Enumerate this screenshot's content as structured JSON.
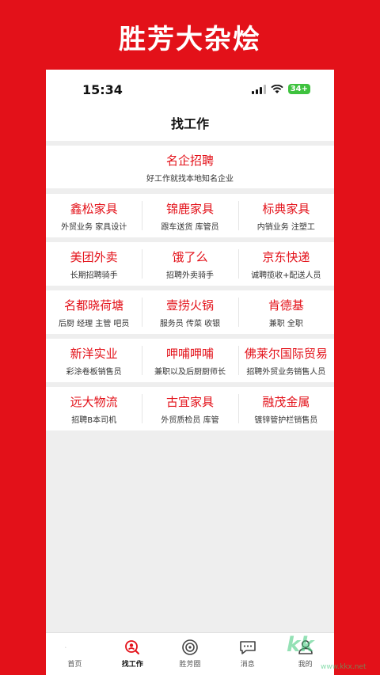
{
  "app_title": "胜芳大杂烩",
  "status_bar": {
    "time": "15:34",
    "battery": "34+"
  },
  "header": {
    "title": "找工作"
  },
  "featured": {
    "title": "名企招聘",
    "subtitle": "好工作就找本地知名企业"
  },
  "companies": [
    [
      {
        "name": "鑫松家具",
        "desc": "外贸业务 家具设计"
      },
      {
        "name": "锦鹿家具",
        "desc": "跟车送货 库管员"
      },
      {
        "name": "标典家具",
        "desc": "内销业务 注塑工"
      }
    ],
    [
      {
        "name": "美团外卖",
        "desc": "长期招聘骑手"
      },
      {
        "name": "饿了么",
        "desc": "招聘外卖骑手"
      },
      {
        "name": "京东快递",
        "desc": "诚聘揽收+配送人员"
      }
    ],
    [
      {
        "name": "名都晓荷塘",
        "desc": "后厨 经理 主管 吧员"
      },
      {
        "name": "壹捞火锅",
        "desc": "服务员 传菜 收银"
      },
      {
        "name": "肯德基",
        "desc": "兼职 全职"
      }
    ],
    [
      {
        "name": "新洋实业",
        "desc": "彩涂卷板销售员"
      },
      {
        "name": "呷哺呷哺",
        "desc": "兼职以及后厨厨师长"
      },
      {
        "name": "佛莱尔国际贸易",
        "desc": "招聘外贸业务销售人员"
      }
    ],
    [
      {
        "name": "远大物流",
        "desc": "招聘B本司机"
      },
      {
        "name": "古宜家具",
        "desc": "外贸质检员 库管"
      },
      {
        "name": "融茂金属",
        "desc": "镀锌管护栏销售员"
      }
    ]
  ],
  "tabs": [
    {
      "label": "首页",
      "icon": "home-icon"
    },
    {
      "label": "找工作",
      "icon": "job-search-icon",
      "active": true
    },
    {
      "label": "胜芳圈",
      "icon": "circle-icon"
    },
    {
      "label": "消息",
      "icon": "message-icon"
    },
    {
      "label": "我的",
      "icon": "profile-icon"
    }
  ],
  "watermark": {
    "text": "kk",
    "url": "www.kkx.net"
  },
  "colors": {
    "accent": "#e31119",
    "background": "#eeeeee"
  }
}
